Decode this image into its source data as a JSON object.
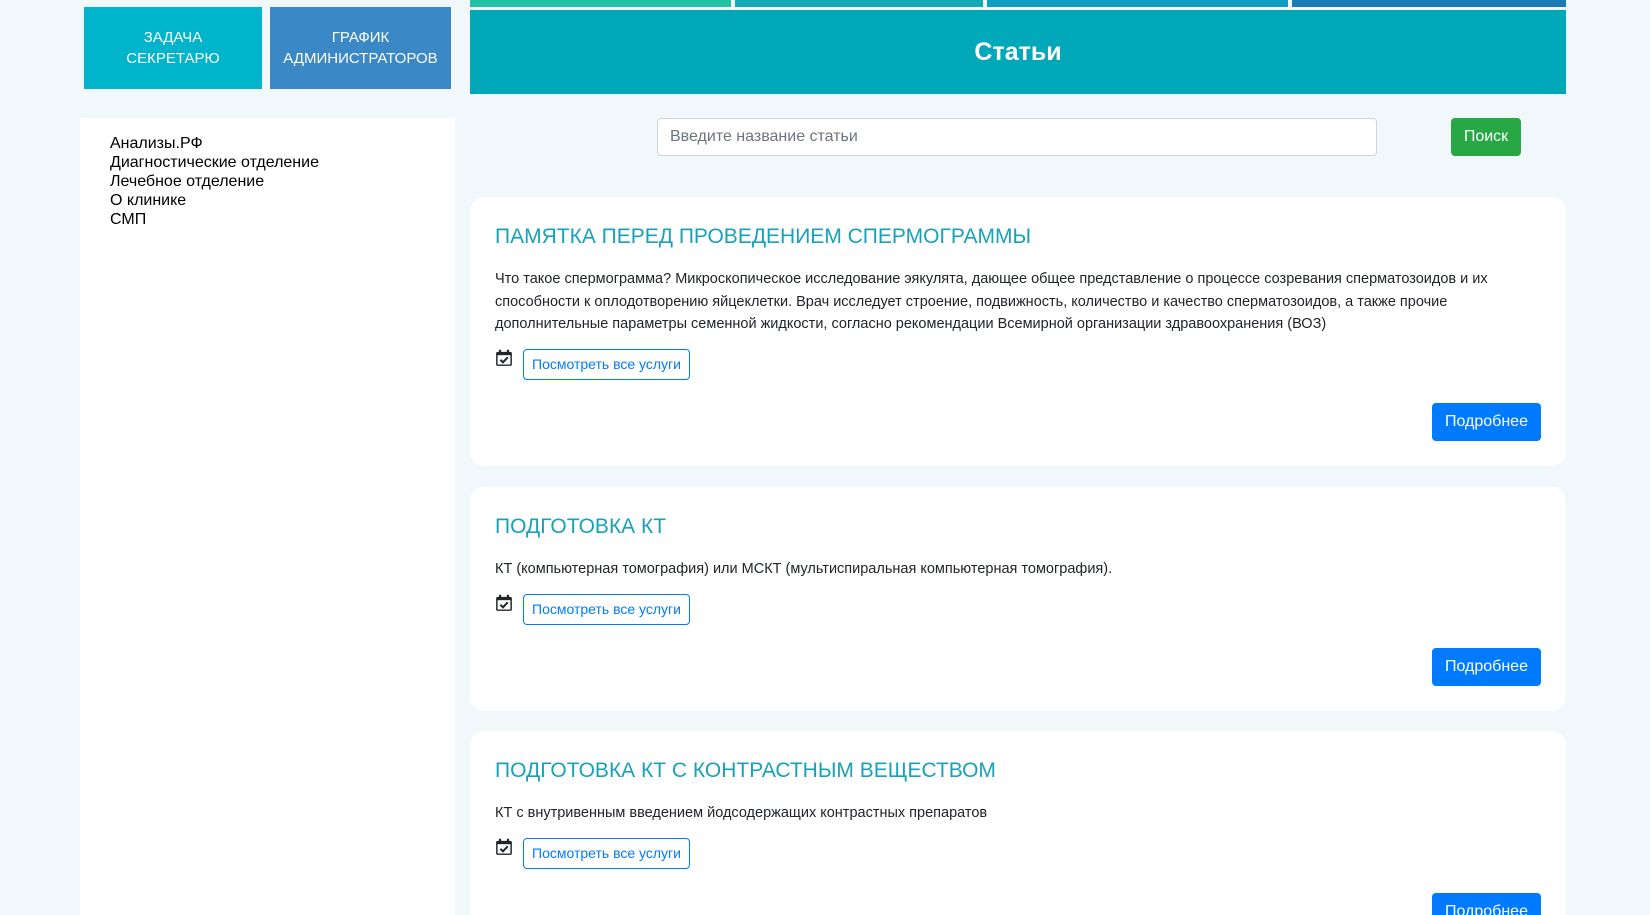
{
  "top_buttons": {
    "secretary_task": [
      "ЗАДАЧА",
      "СЕКРЕТАРЮ"
    ],
    "admin_schedule": [
      "ГРАФИК",
      "АДМИНИСТРАТОРОВ"
    ]
  },
  "header": {
    "title": "Статьи"
  },
  "sidebar": {
    "items": [
      {
        "label": "Анализы.РФ"
      },
      {
        "label": "Диагностические отделение"
      },
      {
        "label": "Лечебное отделение"
      },
      {
        "label": "О клинике"
      },
      {
        "label": "СМП"
      }
    ]
  },
  "search": {
    "placeholder": "Введите название статьи",
    "value": "",
    "button_label": "Поиск"
  },
  "articles": [
    {
      "title": "ПАМЯТКА ПЕРЕД ПРОВЕДЕНИЕМ СПЕРМОГРАММЫ",
      "text": "Что такое спермограмма? Микроскопическое исследование эякулята, дающее общее представление о процессе созревания сперматозоидов и их способности к оплодотворению яйцеклетки. Врач исследует строение, подвижность, количество и качество сперматозоидов, а также прочие дополнительные параметры семенной жидкости, согласно рекомендации Всемирной организации здравоохранения (ВОЗ)",
      "services_label": "Посмотреть все услуги",
      "more_label": "Подробнее"
    },
    {
      "title": "ПОДГОТОВКА КТ",
      "text": "КТ (компьютерная томография) или МСКТ (мультиспиральная компьютерная томография).",
      "services_label": "Посмотреть все услуги",
      "more_label": "Подробнее"
    },
    {
      "title": "ПОДГОТОВКА КТ С КОНТРАСТНЫМ ВЕЩЕСТВОМ",
      "text": "КТ с внутривенным введением йодсодержащих контрастных препаратов",
      "services_label": "Посмотреть все услуги",
      "more_label": "Подробнее"
    }
  ],
  "colors": {
    "secretary_button": "#00b4cc",
    "schedule_button": "#3a88c5",
    "header_banner": "#00a8b9",
    "search_button": "#28a745",
    "more_button": "#007bff",
    "article_title": "#17a2b8",
    "page_background": "#f1f8fb"
  },
  "icons": {
    "service_icon": "calendar-check-icon"
  }
}
